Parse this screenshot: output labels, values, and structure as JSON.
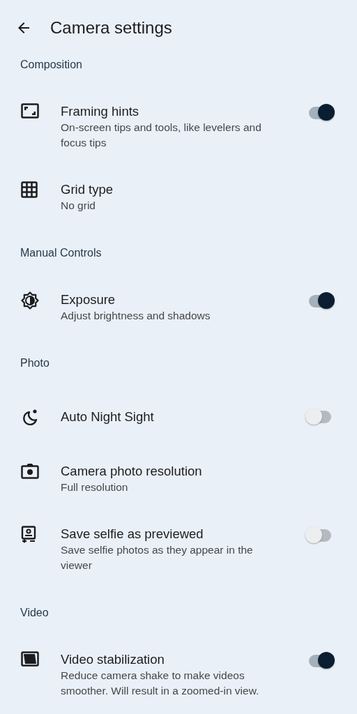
{
  "header": {
    "title": "Camera settings"
  },
  "sections": [
    {
      "title": "Composition",
      "items": [
        {
          "kind": "toggle",
          "title": "Framing hints",
          "subtitle": "On-screen tips and tools, like levelers and focus tips",
          "on": true
        },
        {
          "kind": "plain",
          "title": "Grid type",
          "subtitle": "No grid"
        }
      ]
    },
    {
      "title": "Manual Controls",
      "items": [
        {
          "kind": "toggle",
          "title": "Exposure",
          "subtitle": "Adjust brightness and shadows",
          "on": true
        }
      ]
    },
    {
      "title": "Photo",
      "items": [
        {
          "kind": "toggle",
          "title": "Auto Night Sight",
          "on": false
        },
        {
          "kind": "plain",
          "title": "Camera photo resolution",
          "subtitle": "Full resolution"
        },
        {
          "kind": "toggle",
          "title": "Save selfie as previewed",
          "subtitle": "Save selfie photos as they appear in the viewer",
          "on": false
        }
      ]
    },
    {
      "title": "Video",
      "items": [
        {
          "kind": "toggle",
          "title": "Video stabilization",
          "subtitle": "Reduce camera shake to make videos smoother. Will result in a zoomed-in view.",
          "on": true
        }
      ]
    }
  ]
}
